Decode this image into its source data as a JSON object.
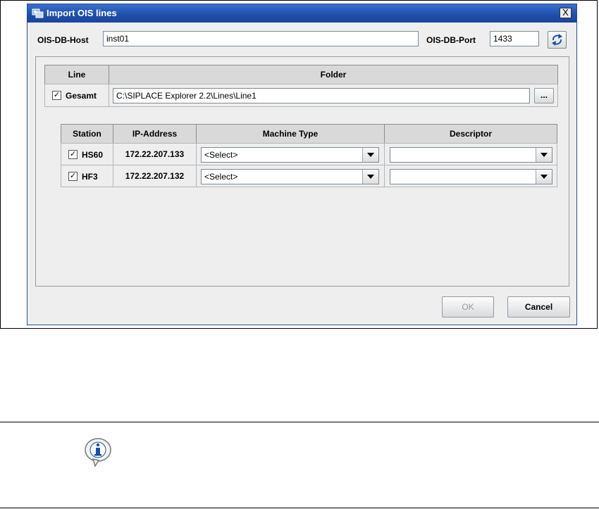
{
  "dialog": {
    "title": "Import OIS lines",
    "close_label": "X",
    "host_label": "OIS-DB-Host",
    "host_value": "inst01",
    "port_label": "OIS-DB-Port",
    "port_value": "1433"
  },
  "line_table": {
    "headers": [
      "Line",
      "Folder"
    ],
    "row": {
      "checked": true,
      "name": "Gesamt",
      "folder": "C:\\SIPLACE Explorer 2.2\\Lines\\Line1",
      "browse_label": "..."
    }
  },
  "station_table": {
    "headers": [
      "Station",
      "IP-Address",
      "Machine Type",
      "Descriptor"
    ],
    "rows": [
      {
        "checked": true,
        "station": "HS60",
        "ip": "172.22.207.133",
        "machine_type": "<Select>",
        "descriptor": ""
      },
      {
        "checked": true,
        "station": "HF3",
        "ip": "172.22.207.132",
        "machine_type": "<Select>",
        "descriptor": ""
      }
    ]
  },
  "buttons": {
    "ok": "OK",
    "cancel": "Cancel"
  },
  "colors": {
    "titlebar": "#1d4ea8",
    "info_icon": "#1a4fa0"
  }
}
